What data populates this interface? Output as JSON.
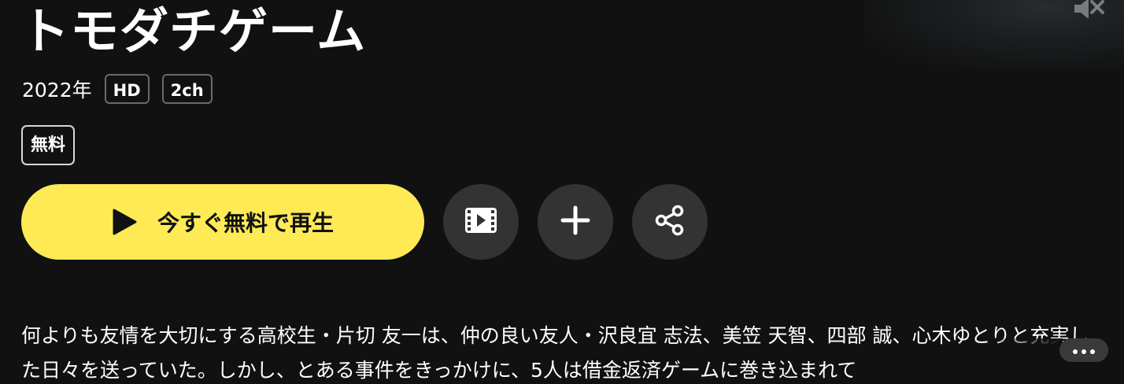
{
  "title": "トモダチゲーム",
  "meta": {
    "year": "2022年",
    "tags": [
      "HD",
      "2ch"
    ]
  },
  "free_badge": "無料",
  "actions": {
    "play_label": "今すぐ無料で再生",
    "trailer_icon": "film-play-icon",
    "add_icon": "plus-icon",
    "share_icon": "share-icon",
    "mute_icon": "speaker-muted-icon",
    "more_icon": "ellipsis-icon"
  },
  "synopsis": "何よりも友情を大切にする高校生・片切 友一は、仲の良い友人・沢良宜 志法、美笠 天智、四部 誠、心木ゆとりと充実した日々を送っていた。しかし、とある事件をきっかけに、5人は借金返済ゲームに巻き込まれて",
  "colors": {
    "background": "#111111",
    "accent": "#fdea55",
    "button_bg": "#333333"
  }
}
